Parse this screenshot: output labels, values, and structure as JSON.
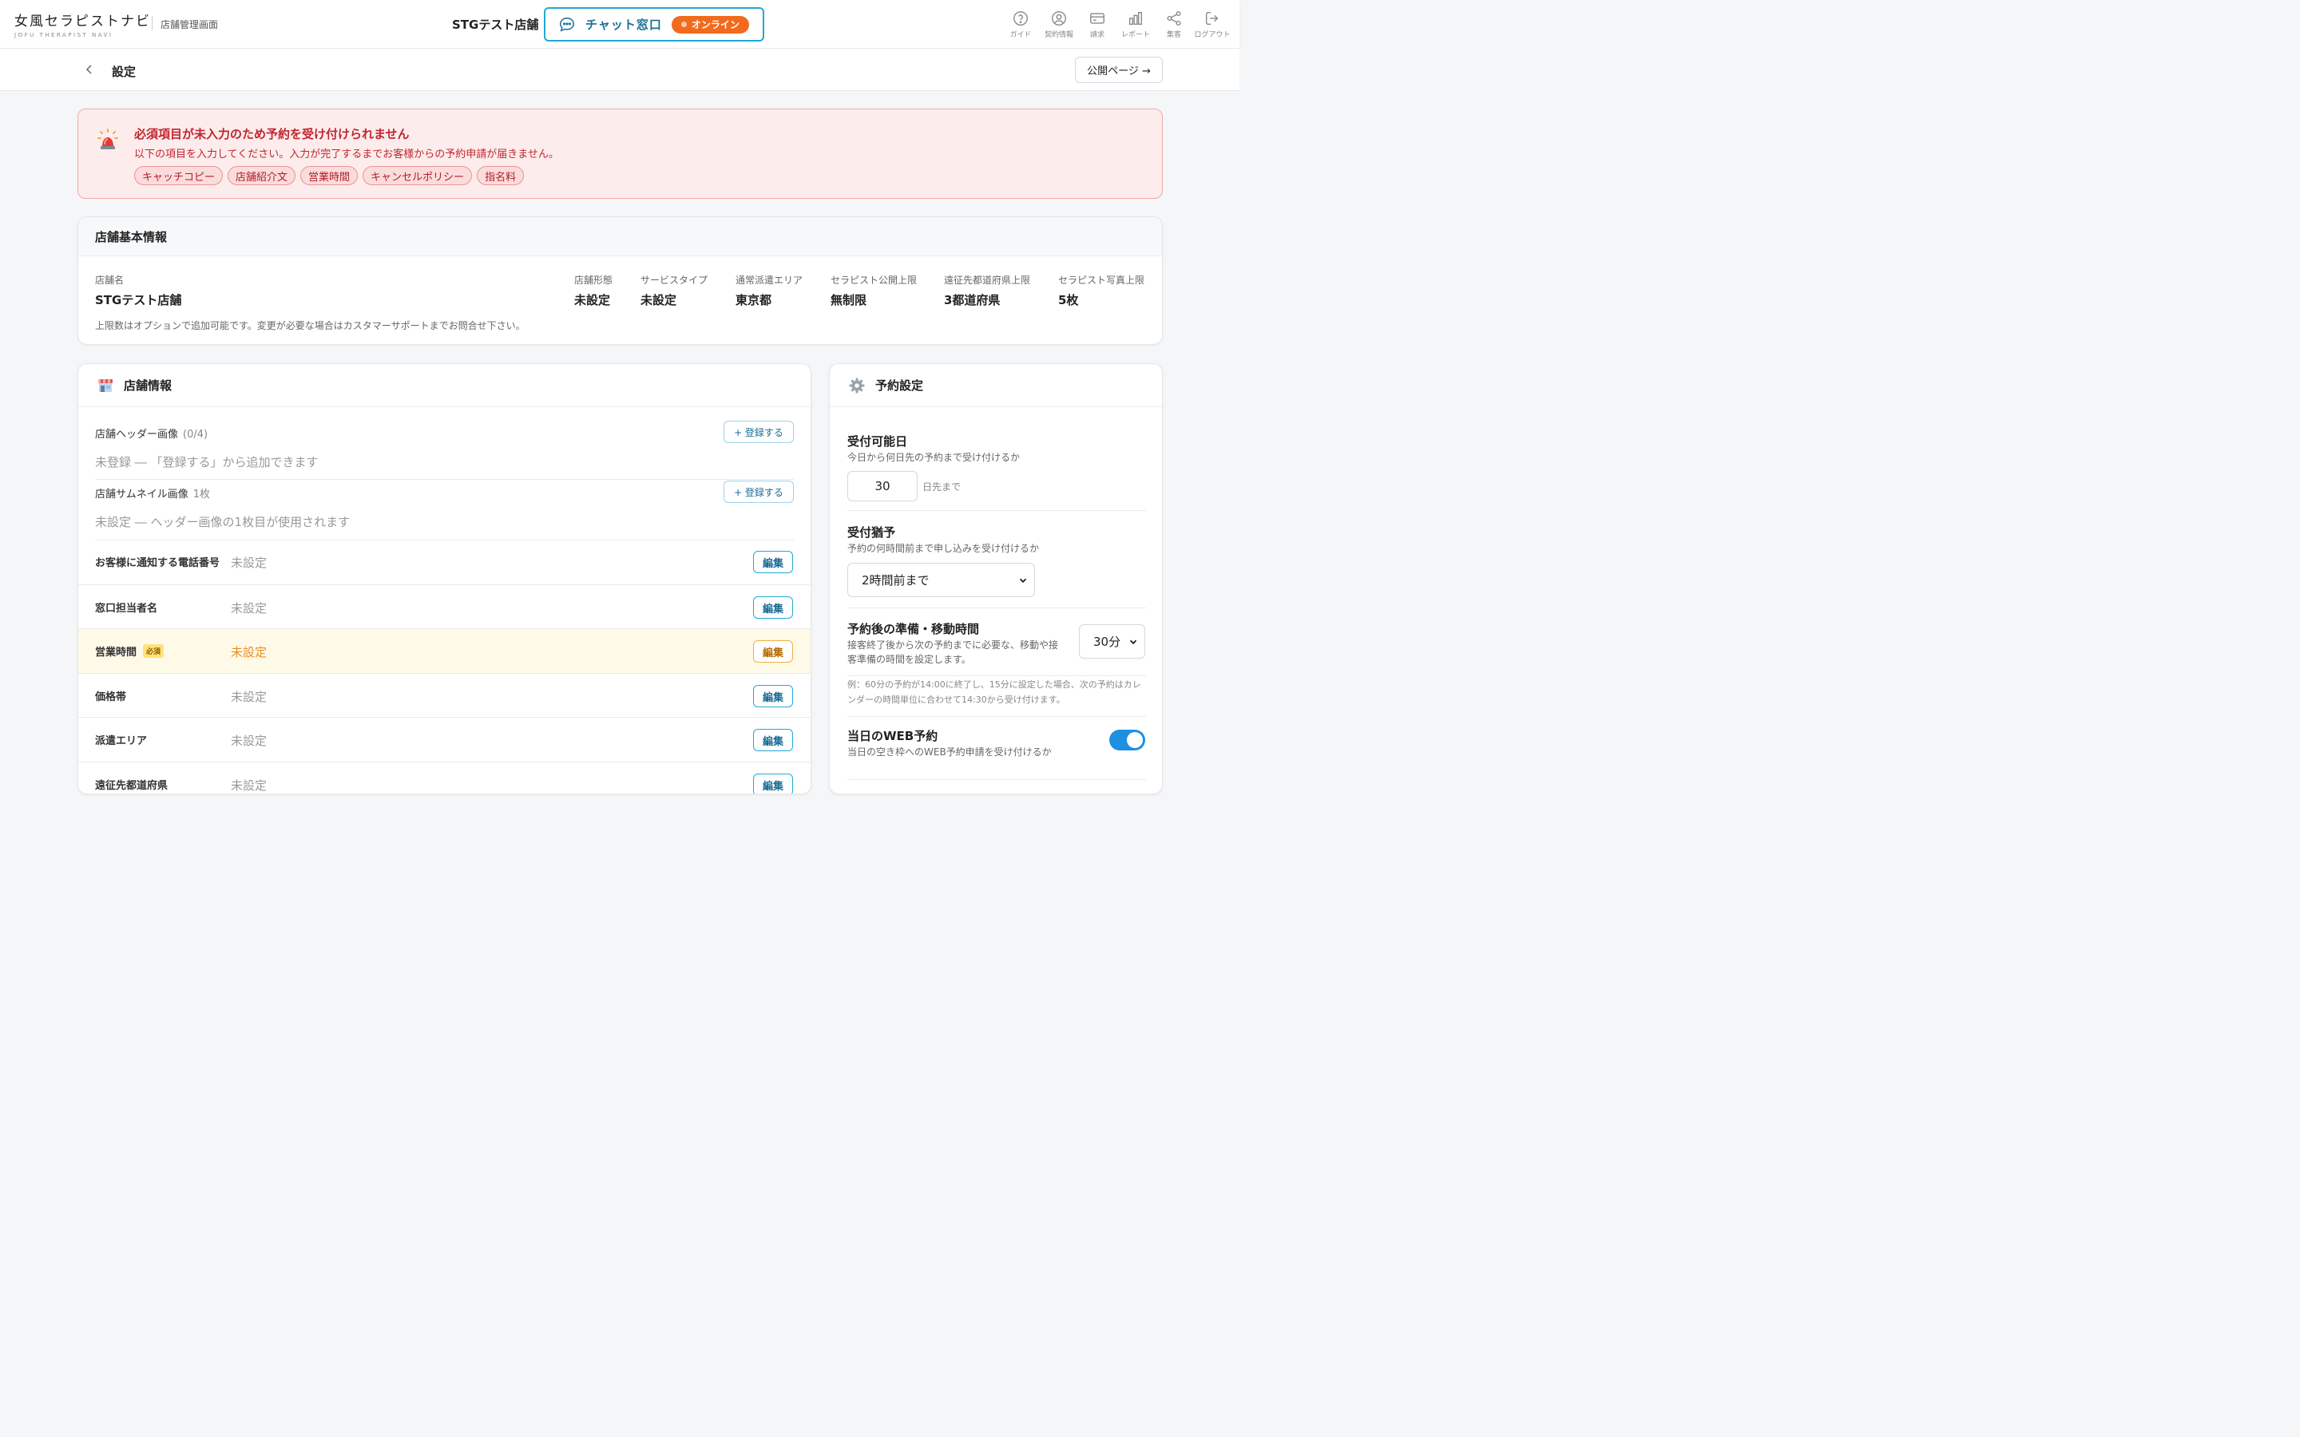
{
  "header": {
    "logo_main": "女風セラピストナビ",
    "logo_sub": "JOFU THERAPIST NAVI",
    "subtitle": "店舗管理画面",
    "shop_name": "STGテスト店舗",
    "chat_label": "チャット窓口",
    "status_label": "オンライン",
    "accent_color": "#22a8d8",
    "status_color": "#f26b1d",
    "nav": [
      {
        "label": "ガイド",
        "icon": "help-circle-icon"
      },
      {
        "label": "契約情報",
        "icon": "user-circle-icon"
      },
      {
        "label": "請求",
        "icon": "credit-card-icon"
      },
      {
        "label": "レポート",
        "icon": "bar-chart-icon"
      },
      {
        "label": "集客",
        "icon": "share-icon"
      },
      {
        "label": "ログアウト",
        "icon": "logout-icon"
      }
    ]
  },
  "subbar": {
    "title": "設定",
    "public_page_label": "公開ページ →"
  },
  "alert": {
    "title": "必須項目が未入力のため予約を受け付けられません",
    "description": "以下の項目を入力してください。入力が完了するまでお客様からの予約申請が届きません。",
    "tags": [
      "キャッチコピー",
      "店舗紹介文",
      "営業時間",
      "キャンセルポリシー",
      "指名料"
    ]
  },
  "basic_info": {
    "title": "店舗基本情報",
    "shop_name_label": "店舗名",
    "shop_name_value": "STGテスト店舗",
    "fields": [
      {
        "label": "店舗形態",
        "value": "未設定"
      },
      {
        "label": "サービスタイプ",
        "value": "未設定"
      },
      {
        "label": "通常派遣エリア",
        "value": "東京都"
      },
      {
        "label": "セラピスト公開上限",
        "value": "無制限"
      },
      {
        "label": "遠征先都道府県上限",
        "value": "3都道府県"
      },
      {
        "label": "セラピスト写真上限",
        "value": "5枚"
      }
    ],
    "note": "上限数はオプションで追加可能です。変更が必要な場合はカスタマーサポートまでお問合せ下さい。"
  },
  "shop_info": {
    "title": "店舗情報",
    "header_image": {
      "label": "店舗ヘッダー画像",
      "count": "(0/4)",
      "empty": "未登録 ― 「登録する」から追加できます",
      "button": "+ 登録する"
    },
    "thumbnail_image": {
      "label": "店舗サムネイル画像",
      "count": "1枚",
      "empty": "未設定 ― ヘッダー画像の1枚目が使用されます",
      "button": "+ 登録する"
    },
    "rows": [
      {
        "label": "お客様に通知する電話番号",
        "value": "未設定",
        "button": "編集"
      },
      {
        "label": "窓口担当者名",
        "value": "未設定",
        "button": "編集"
      },
      {
        "label": "営業時間",
        "badge": "必須",
        "value": "未設定",
        "button": "編集"
      },
      {
        "label": "価格帯",
        "value": "未設定",
        "button": "編集"
      },
      {
        "label": "派遣エリア",
        "value": "未設定",
        "button": "編集"
      },
      {
        "label": "遠征先都道府県",
        "value": "未設定",
        "button": "編集"
      }
    ]
  },
  "reservation": {
    "title": "予約設定",
    "accept_days": {
      "title": "受付可能日",
      "desc": "今日から何日先の予約まで受け付けるか",
      "value": "30",
      "suffix": "日先まで"
    },
    "grace": {
      "title": "受付猶予",
      "desc": "予約の何時間前まで申し込みを受け付けるか",
      "selected": "2時間前まで"
    },
    "prep": {
      "title": "予約後の準備・移動時間",
      "desc": "接客終了後から次の予約までに必要な、移動や接客準備の時間を設定します。",
      "selected": "30分",
      "note": "例：60分の予約が14:00に終了し、15分に設定した場合、次の予約はカレンダーの時間単位に合わせて14:30から受け付けます。"
    },
    "same_day": {
      "title": "当日のWEB予約",
      "desc": "当日の空き枠へのWEB予約申請を受け付けるか",
      "enabled": "on"
    }
  }
}
